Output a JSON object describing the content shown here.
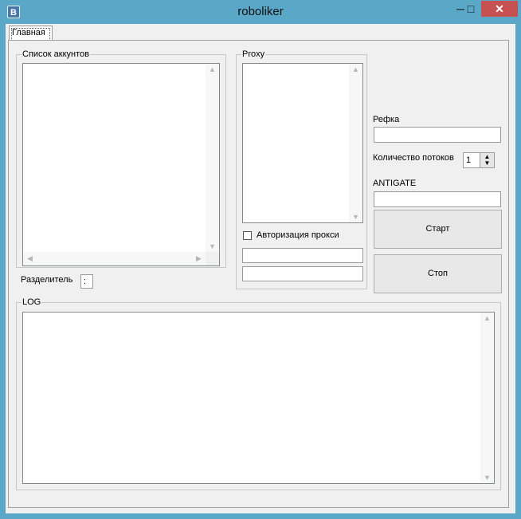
{
  "window": {
    "title": "roboliker",
    "app_icon": "B",
    "minimize": "─",
    "maximize": "□",
    "close": "✕"
  },
  "tabs": [
    {
      "label": "Главная",
      "selected": true
    }
  ],
  "accounts": {
    "legend": "Список аккунтов",
    "items": [],
    "separator_label": "Разделитель",
    "separator_value": ":"
  },
  "proxy": {
    "legend": "Proxy",
    "items": [],
    "auth_label": "Авторизация прокси",
    "auth_checked": false,
    "login_value": "",
    "password_value": ""
  },
  "settings": {
    "refka_label": "Рефка",
    "refka_value": "",
    "threads_label": "Количество потоков",
    "threads_value": "1",
    "antigate_label": "ANTIGATE",
    "antigate_value": "",
    "start_label": "Старт",
    "stop_label": "Стоп"
  },
  "log": {
    "legend": "LOG",
    "content": ""
  },
  "icons": {
    "scroll_up": "▲",
    "scroll_down": "▼",
    "scroll_left": "◀",
    "scroll_right": "▶"
  }
}
